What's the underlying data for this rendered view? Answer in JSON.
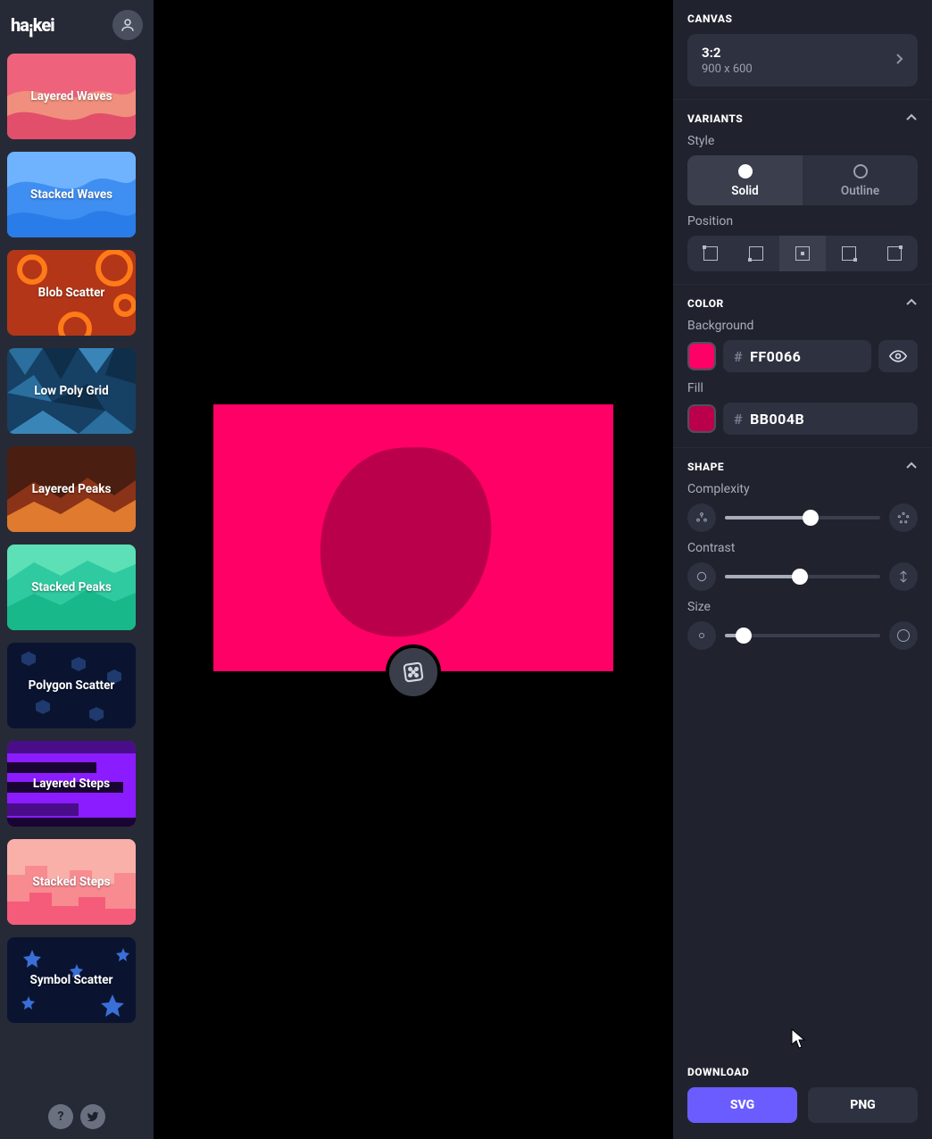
{
  "app": {
    "logo_part1": "ha",
    "logo_part2": "ke",
    "logo_i_down": "¡",
    "logo_i_up": "i"
  },
  "sidebar": {
    "items": [
      {
        "label": "Layered Waves",
        "bg1": "#ee627c",
        "bg2": "#f08f7d"
      },
      {
        "label": "Stacked Waves",
        "bg1": "#2a7de8",
        "bg2": "#6fb3ff"
      },
      {
        "label": "Blob Scatter",
        "bg1": "#b23617",
        "bg2": "#ff7a18"
      },
      {
        "label": "Low Poly Grid",
        "bg1": "#0f2e4a",
        "bg2": "#2a6f9e"
      },
      {
        "label": "Layered Peaks",
        "bg1": "#8a3318",
        "bg2": "#e07a2e"
      },
      {
        "label": "Stacked Peaks",
        "bg1": "#18b88a",
        "bg2": "#5de0b6"
      },
      {
        "label": "Polygon Scatter",
        "bg1": "#0a1430",
        "bg2": "#1f3a6e"
      },
      {
        "label": "Layered Steps",
        "bg1": "#8b1cff",
        "bg2": "#4a0d8a"
      },
      {
        "label": "Stacked Steps",
        "bg1": "#f45c7a",
        "bg2": "#f8b0a8"
      },
      {
        "label": "Symbol Scatter",
        "bg1": "#0a1430",
        "bg2": "#3a6fd8"
      }
    ]
  },
  "canvas_section": {
    "title": "CANVAS",
    "ratio": "3:2",
    "dims": "900 x 600"
  },
  "variants": {
    "title": "VARIANTS",
    "style_label": "Style",
    "solid": "Solid",
    "outline": "Outline",
    "position_label": "Position"
  },
  "color_section": {
    "title": "COLOR",
    "bg_label": "Background",
    "bg_hex": "FF0066",
    "fill_label": "Fill",
    "fill_hex": "BB004B"
  },
  "shape": {
    "title": "SHAPE",
    "complexity": "Complexity",
    "contrast": "Contrast",
    "size": "Size",
    "complexity_pct": 55,
    "contrast_pct": 48,
    "size_pct": 12
  },
  "download": {
    "title": "DOWNLOAD",
    "svg": "SVG",
    "png": "PNG"
  },
  "colors": {
    "canvas_bg": "#ff0066",
    "blob_fill": "#bb004b",
    "accent": "#6b5cff"
  }
}
